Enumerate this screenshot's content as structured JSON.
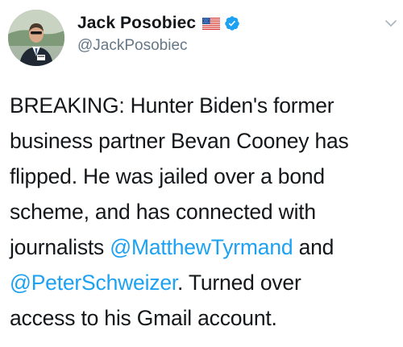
{
  "tweet": {
    "author": {
      "display_name": "Jack Posobiec",
      "handle": "@JackPosobiec",
      "verified": true,
      "flag": "us-flag-icon",
      "avatar": "avatar-photo"
    },
    "body": {
      "line1": "BREAKING: Hunter Biden's former",
      "line2": "business partner Bevan Cooney has",
      "line3": "flipped. He was jailed over a bond",
      "line4": "scheme, and has connected with",
      "line5_prefix": "journalists ",
      "mention1": "@MatthewTyrmand",
      "line5_suffix": " and",
      "mention2": "@PeterSchweizer",
      "line6_suffix": ". Turned over",
      "line7": "access to his Gmail account."
    },
    "colors": {
      "text": "#14171a",
      "secondary": "#657786",
      "link": "#1da1f2",
      "verified": "#1da1f2"
    },
    "icons": {
      "options": "chevron-down-icon",
      "verified": "verified-badge-icon"
    }
  }
}
